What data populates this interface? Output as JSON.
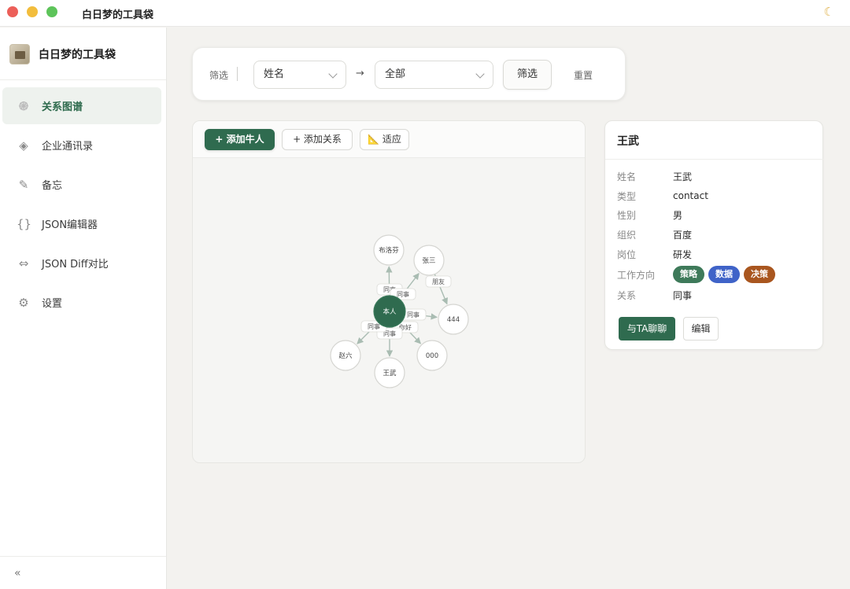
{
  "window": {
    "title": "白日梦的工具袋",
    "theme_icon": "moon-icon"
  },
  "sidebar": {
    "brand": "白日梦的工具袋",
    "items": [
      {
        "label": "关系图谱",
        "icon": "web-icon",
        "glyph": "֎",
        "active": true
      },
      {
        "label": "企业通讯录",
        "icon": "diamond-icon",
        "glyph": "◈",
        "active": false
      },
      {
        "label": "备忘",
        "icon": "pencil-icon",
        "glyph": "✎",
        "active": false
      },
      {
        "label": "JSON编辑器",
        "icon": "braces-icon",
        "glyph": "{}",
        "active": false
      },
      {
        "label": "JSON Diff对比",
        "icon": "diff-arrows-icon",
        "glyph": "⇔",
        "active": false
      },
      {
        "label": "设置",
        "icon": "gear-icon",
        "glyph": "⚙",
        "active": false
      }
    ],
    "collapse_glyph": "«"
  },
  "filter": {
    "label": "筛选",
    "field_select": "姓名",
    "arrow": "→",
    "value_select": "全部",
    "filter_button": "筛选",
    "reset_button": "重置"
  },
  "graph": {
    "toolbar": {
      "add_person": "+ 添加牛人",
      "add_relation": "+ 添加关系",
      "fit": "📐 适应"
    },
    "nodes": [
      {
        "id": "self",
        "label": "本人",
        "center": true
      },
      {
        "id": "bulofen",
        "label": "布洛芬"
      },
      {
        "id": "zhangsan",
        "label": "张三"
      },
      {
        "id": "n444",
        "label": "444"
      },
      {
        "id": "n000",
        "label": "000"
      },
      {
        "id": "wangwu",
        "label": "王武"
      },
      {
        "id": "zhaoliu",
        "label": "赵六"
      }
    ],
    "edges": [
      {
        "from": "self",
        "to": "bulofen",
        "label": "同事"
      },
      {
        "from": "self",
        "to": "zhangsan",
        "label": "同事"
      },
      {
        "from": "zhangsan",
        "to": "n444",
        "label": "朋友"
      },
      {
        "from": "self",
        "to": "n444",
        "label": "同事"
      },
      {
        "from": "self",
        "to": "n000",
        "label": "你好"
      },
      {
        "from": "self",
        "to": "wangwu",
        "label": "同事"
      },
      {
        "from": "self",
        "to": "zhaoliu",
        "label": "同事"
      }
    ]
  },
  "detail": {
    "title": "王武",
    "fields": [
      {
        "key": "姓名",
        "value": "王武"
      },
      {
        "key": "类型",
        "value": "contact"
      },
      {
        "key": "性别",
        "value": "男"
      },
      {
        "key": "组织",
        "value": "百度"
      },
      {
        "key": "岗位",
        "value": "研发"
      }
    ],
    "work_direction_label": "工作方向",
    "tags": [
      {
        "label": "策略",
        "color": "#3e7a5a"
      },
      {
        "label": "数据",
        "color": "#3f63c8"
      },
      {
        "label": "决策",
        "color": "#a9561f"
      }
    ],
    "relation_label": "关系",
    "relation_value": "同事",
    "chat_button": "与TA聊聊",
    "edit_button": "编辑"
  },
  "colors": {
    "accent": "#2f6b4f",
    "edge": "#a9bcb2"
  }
}
